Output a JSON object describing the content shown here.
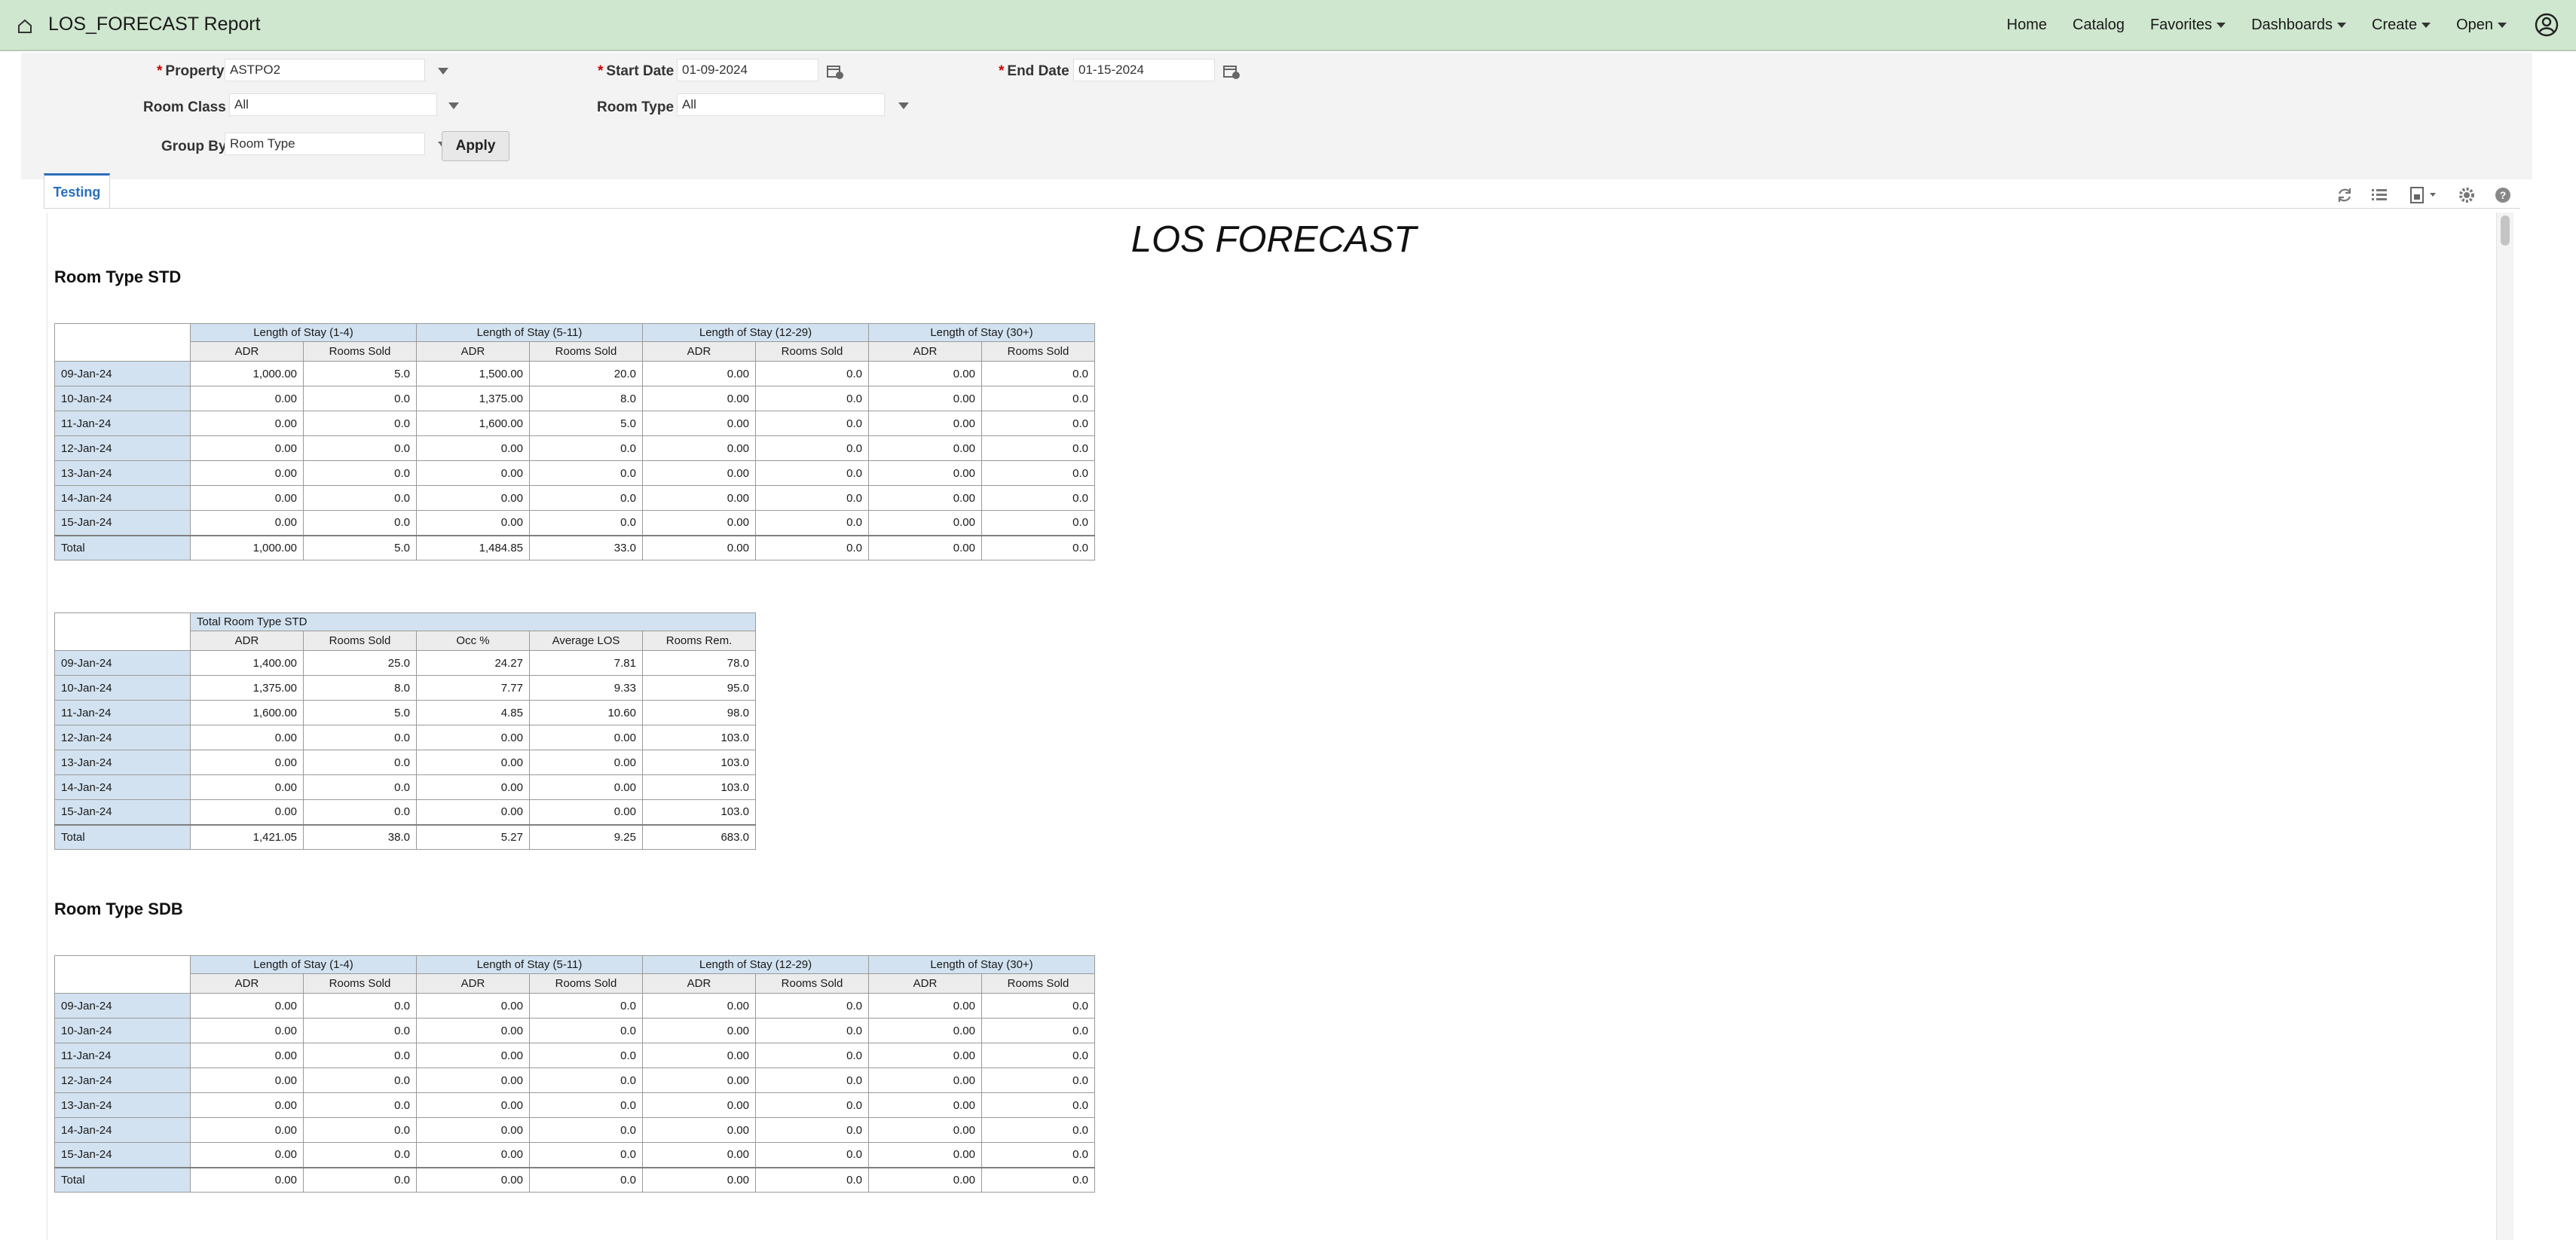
{
  "header": {
    "title": "LOS_FORECAST Report",
    "nav": [
      {
        "label": "Home",
        "dropdown": false
      },
      {
        "label": "Catalog",
        "dropdown": false
      },
      {
        "label": "Favorites",
        "dropdown": true
      },
      {
        "label": "Dashboards",
        "dropdown": true
      },
      {
        "label": "Create",
        "dropdown": true
      },
      {
        "label": "Open",
        "dropdown": true
      }
    ]
  },
  "prompts": {
    "required_mark": "*",
    "property": {
      "label": "Property",
      "value": "ASTPO2"
    },
    "start_date": {
      "label": "Start Date",
      "value": "01-09-2024"
    },
    "end_date": {
      "label": "End Date",
      "value": "01-15-2024"
    },
    "room_class": {
      "label": "Room Class",
      "value": "All"
    },
    "room_type": {
      "label": "Room Type",
      "value": "All"
    },
    "group_by": {
      "label": "Group By",
      "value": "Room Type"
    },
    "apply_label": "Apply"
  },
  "tabs": [
    {
      "label": "Testing",
      "active": true
    }
  ],
  "report": {
    "title": "LOS FORECAST",
    "los_groups": [
      "Length of Stay (1-4)",
      "Length of Stay (5-11)",
      "Length of Stay (12-29)",
      "Length of Stay (30+)"
    ],
    "los_sub": [
      "ADR",
      "Rooms Sold"
    ],
    "total_sub": [
      "ADR",
      "Rooms Sold",
      "Occ %",
      "Average LOS",
      "Rooms Rem."
    ],
    "sections": [
      {
        "heading": "Room Type STD",
        "los_rows": [
          {
            "date": "09-Jan-24",
            "v": [
              "1,000.00",
              "5.0",
              "1,500.00",
              "20.0",
              "0.00",
              "0.0",
              "0.00",
              "0.0"
            ]
          },
          {
            "date": "10-Jan-24",
            "v": [
              "0.00",
              "0.0",
              "1,375.00",
              "8.0",
              "0.00",
              "0.0",
              "0.00",
              "0.0"
            ]
          },
          {
            "date": "11-Jan-24",
            "v": [
              "0.00",
              "0.0",
              "1,600.00",
              "5.0",
              "0.00",
              "0.0",
              "0.00",
              "0.0"
            ]
          },
          {
            "date": "12-Jan-24",
            "v": [
              "0.00",
              "0.0",
              "0.00",
              "0.0",
              "0.00",
              "0.0",
              "0.00",
              "0.0"
            ]
          },
          {
            "date": "13-Jan-24",
            "v": [
              "0.00",
              "0.0",
              "0.00",
              "0.0",
              "0.00",
              "0.0",
              "0.00",
              "0.0"
            ]
          },
          {
            "date": "14-Jan-24",
            "v": [
              "0.00",
              "0.0",
              "0.00",
              "0.0",
              "0.00",
              "0.0",
              "0.00",
              "0.0"
            ]
          },
          {
            "date": "15-Jan-24",
            "v": [
              "0.00",
              "0.0",
              "0.00",
              "0.0",
              "0.00",
              "0.0",
              "0.00",
              "0.0"
            ]
          },
          {
            "date": "Total",
            "v": [
              "1,000.00",
              "5.0",
              "1,484.85",
              "33.0",
              "0.00",
              "0.0",
              "0.00",
              "0.0"
            ]
          }
        ],
        "total_header": "Total Room Type STD",
        "total_rows": [
          {
            "date": "09-Jan-24",
            "v": [
              "1,400.00",
              "25.0",
              "24.27",
              "7.81",
              "78.0"
            ]
          },
          {
            "date": "10-Jan-24",
            "v": [
              "1,375.00",
              "8.0",
              "7.77",
              "9.33",
              "95.0"
            ]
          },
          {
            "date": "11-Jan-24",
            "v": [
              "1,600.00",
              "5.0",
              "4.85",
              "10.60",
              "98.0"
            ]
          },
          {
            "date": "12-Jan-24",
            "v": [
              "0.00",
              "0.0",
              "0.00",
              "0.00",
              "103.0"
            ]
          },
          {
            "date": "13-Jan-24",
            "v": [
              "0.00",
              "0.0",
              "0.00",
              "0.00",
              "103.0"
            ]
          },
          {
            "date": "14-Jan-24",
            "v": [
              "0.00",
              "0.0",
              "0.00",
              "0.00",
              "103.0"
            ]
          },
          {
            "date": "15-Jan-24",
            "v": [
              "0.00",
              "0.0",
              "0.00",
              "0.00",
              "103.0"
            ]
          },
          {
            "date": "Total",
            "v": [
              "1,421.05",
              "38.0",
              "5.27",
              "9.25",
              "683.0"
            ]
          }
        ]
      },
      {
        "heading": "Room Type SDB",
        "los_rows": [
          {
            "date": "09-Jan-24",
            "v": [
              "0.00",
              "0.0",
              "0.00",
              "0.0",
              "0.00",
              "0.0",
              "0.00",
              "0.0"
            ]
          },
          {
            "date": "10-Jan-24",
            "v": [
              "0.00",
              "0.0",
              "0.00",
              "0.0",
              "0.00",
              "0.0",
              "0.00",
              "0.0"
            ]
          },
          {
            "date": "11-Jan-24",
            "v": [
              "0.00",
              "0.0",
              "0.00",
              "0.0",
              "0.00",
              "0.0",
              "0.00",
              "0.0"
            ]
          },
          {
            "date": "12-Jan-24",
            "v": [
              "0.00",
              "0.0",
              "0.00",
              "0.0",
              "0.00",
              "0.0",
              "0.00",
              "0.0"
            ]
          },
          {
            "date": "13-Jan-24",
            "v": [
              "0.00",
              "0.0",
              "0.00",
              "0.0",
              "0.00",
              "0.0",
              "0.00",
              "0.0"
            ]
          },
          {
            "date": "14-Jan-24",
            "v": [
              "0.00",
              "0.0",
              "0.00",
              "0.0",
              "0.00",
              "0.0",
              "0.00",
              "0.0"
            ]
          },
          {
            "date": "15-Jan-24",
            "v": [
              "0.00",
              "0.0",
              "0.00",
              "0.0",
              "0.00",
              "0.0",
              "0.00",
              "0.0"
            ]
          },
          {
            "date": "Total",
            "v": [
              "0.00",
              "0.0",
              "0.00",
              "0.0",
              "0.00",
              "0.0",
              "0.00",
              "0.0"
            ]
          }
        ]
      }
    ]
  },
  "toolbar_icons": [
    "refresh-icon",
    "list-icon",
    "export-icon",
    "settings-icon",
    "help-icon"
  ]
}
